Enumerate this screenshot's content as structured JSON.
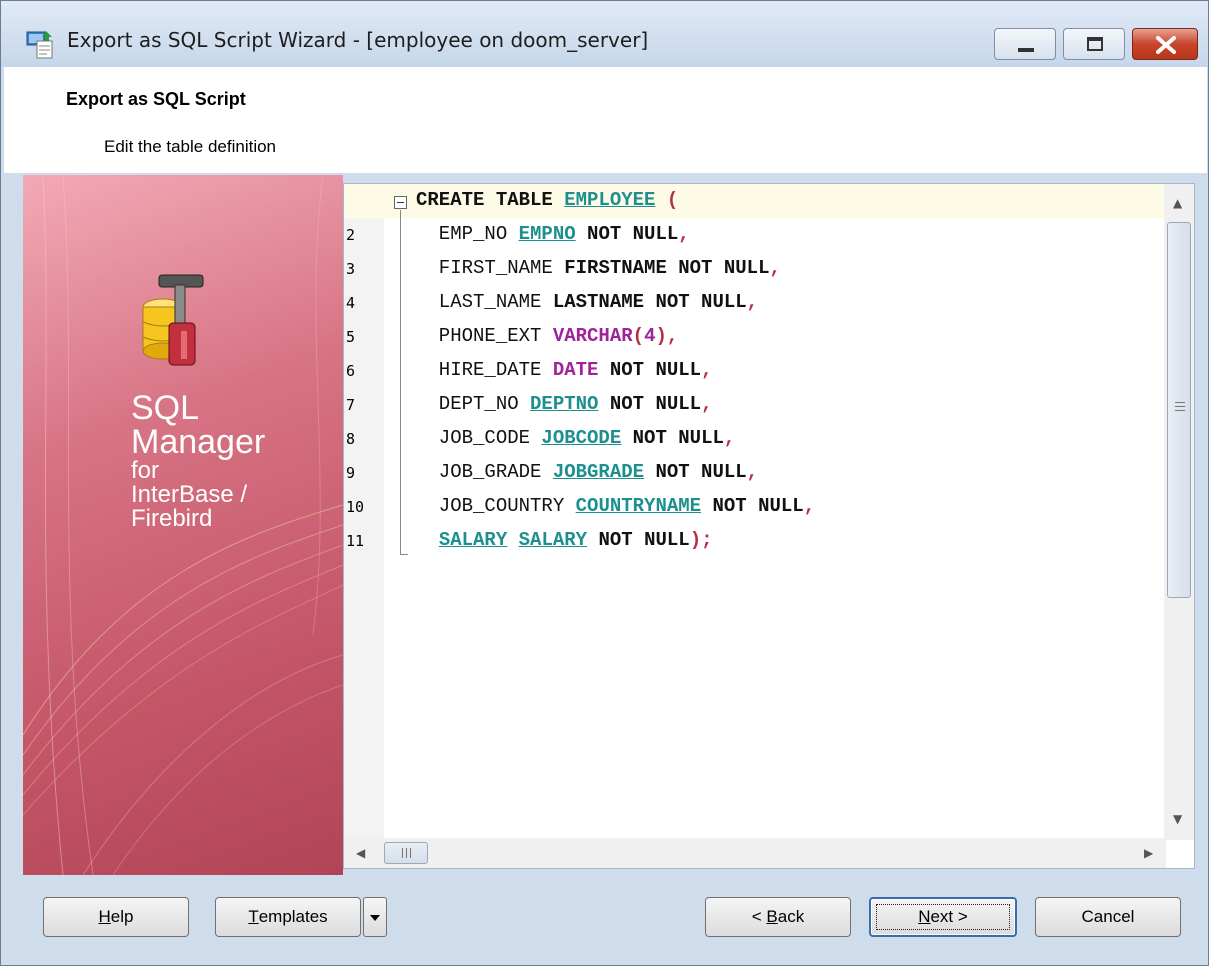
{
  "window": {
    "title": "Export as SQL Script Wizard - [employee on doom_server]"
  },
  "header": {
    "title": "Export as SQL Script",
    "subtitle": "Edit the table definition"
  },
  "banner": {
    "line1": "SQL",
    "line2": "Manager",
    "line3": "for",
    "line4": "InterBase /",
    "line5": "Firebird"
  },
  "editor": {
    "line_numbers": [
      "",
      "2",
      "3",
      "4",
      "5",
      "6",
      "7",
      "8",
      "9",
      "10",
      "11"
    ],
    "lines": [
      "CREATE TABLE EMPLOYEE (",
      "  EMP_NO EMPNO NOT NULL,",
      "  FIRST_NAME FIRSTNAME NOT NULL,",
      "  LAST_NAME LASTNAME NOT NULL,",
      "  PHONE_EXT VARCHAR(4),",
      "  HIRE_DATE DATE NOT NULL,",
      "  DEPT_NO DEPTNO NOT NULL,",
      "  JOB_CODE JOBCODE NOT NULL,",
      "  JOB_GRADE JOBGRADE NOT NULL,",
      "  JOB_COUNTRY COUNTRYNAME NOT NULL,",
      "  SALARY SALARY NOT NULL);"
    ]
  },
  "buttons": {
    "help_mnemonic": "H",
    "help_rest": "elp",
    "templates_mnemonic": "T",
    "templates_rest": "emplates",
    "back_prefix": "< ",
    "back_mnemonic": "B",
    "back_rest": "ack",
    "next_mnemonic": "N",
    "next_rest": "ext >",
    "cancel": "Cancel"
  },
  "colors": {
    "accent": "#3a6ea8",
    "banner": "#c45668",
    "sql_reference": "#1d8f8f",
    "sql_type": "#a0239c",
    "sql_punct": "#b5303f"
  },
  "icons": {
    "app": "sql-wizard-icon",
    "banner": "database-tools-icon"
  }
}
